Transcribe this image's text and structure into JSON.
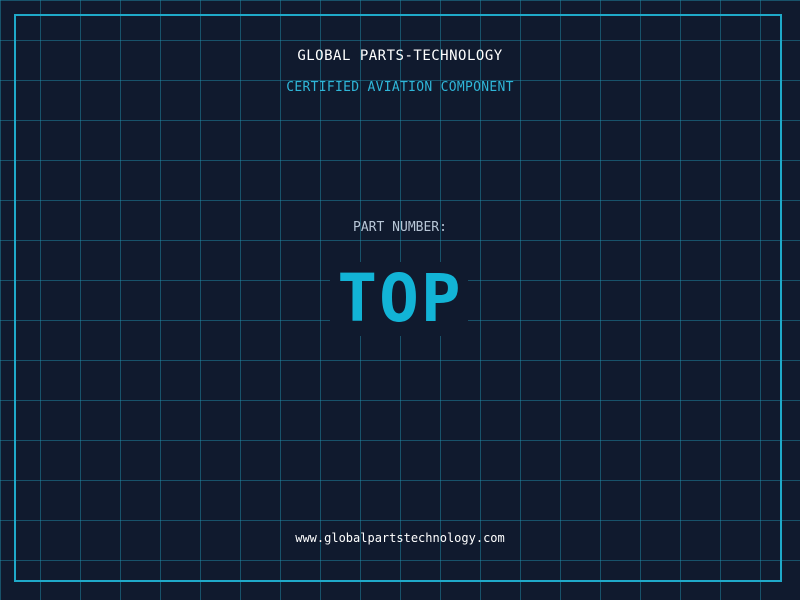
{
  "header": {
    "company": "GLOBAL PARTS-TECHNOLOGY",
    "tagline": "CERTIFIED AVIATION COMPONENT"
  },
  "part": {
    "label": "PART NUMBER:",
    "value": "TOP"
  },
  "footer": {
    "website": "www.globalpartstechnology.com"
  },
  "colors": {
    "background": "#101a2e",
    "grid": "#2296b4",
    "accent": "#12b4d6",
    "border": "#1fa9c9",
    "text": "#ffffff"
  }
}
